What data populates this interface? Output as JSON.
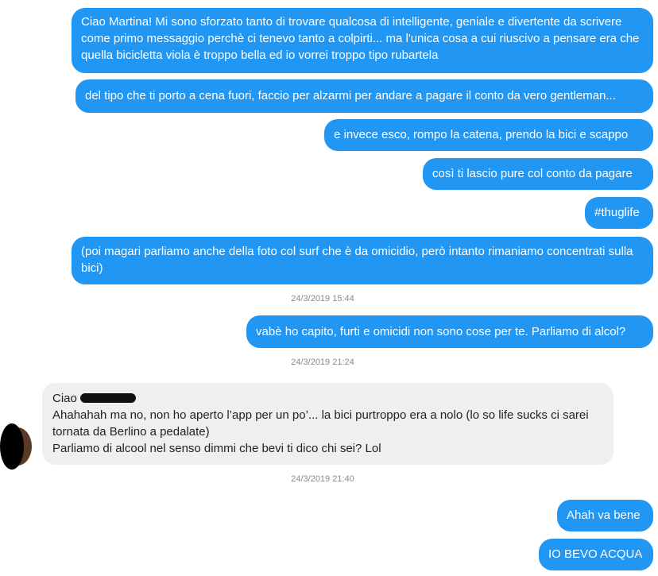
{
  "conversation": {
    "messages_block1": [
      "Ciao Martina! Mi sono sforzato tanto di trovare qualcosa di intelligente, geniale e divertente da scrivere come primo messaggio perchè ci tenevo tanto a colpirti... ma l'unica cosa a cui riuscivo a pensare era che quella bicicletta viola è troppo bella ed io vorrei troppo tipo rubartela",
      "del tipo che ti porto a cena fuori, faccio per alzarmi per andare a pagare il conto da vero gentleman...",
      "e invece esco, rompo la catena, prendo la bici e scappo",
      "così ti lascio pure col conto da pagare",
      "#thuglife",
      "(poi magari parliamo anche della foto col surf che è da omicidio, però intanto rimaniamo concentrati sulla bici)"
    ],
    "timestamp_1": "24/3/2019 15:44",
    "message_block2": "vabè ho capito, furti e omicidi non sono cose per te. Parliamo di alcol?",
    "timestamp_2": "24/3/2019 21:24",
    "reply": {
      "greeting": "Ciao",
      "line1": "Ahahahah ma no, non ho aperto l’app per un po’... la bici purtroppo era a nolo (lo so life sucks ci sarei tornata da Berlino a pedalate)",
      "line2": "Parliamo di alcool nel senso dimmi che bevi ti dico chi sei? Lol"
    },
    "timestamp_3": "24/3/2019 21:40",
    "messages_block3": [
      "Ahah va bene",
      "IO BEVO ACQUA"
    ]
  },
  "colors": {
    "outgoing_bubble": "#2196f3",
    "incoming_bubble": "#efefef",
    "timestamp_text": "#8a8a8a"
  }
}
